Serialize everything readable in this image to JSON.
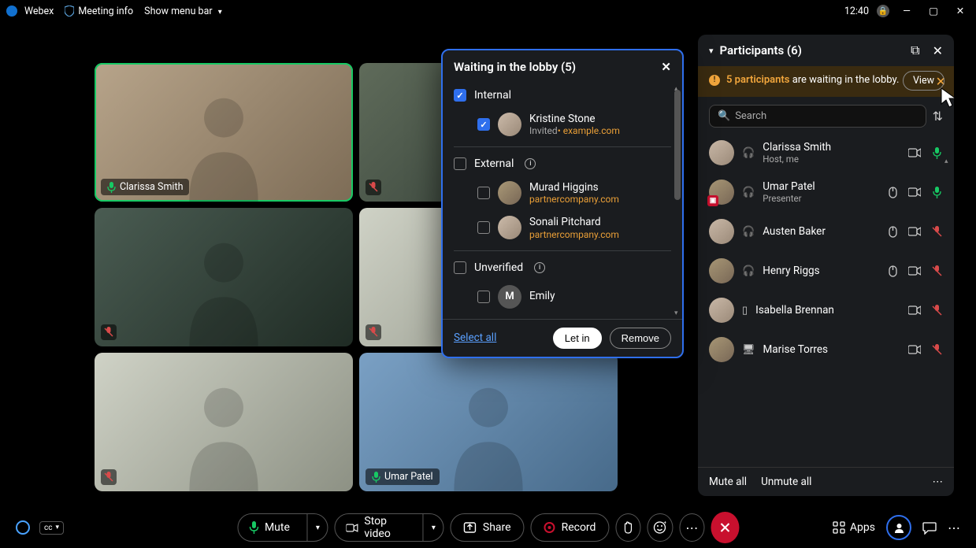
{
  "titlebar": {
    "app": "Webex",
    "meeting_info": "Meeting info",
    "show_menu": "Show menu bar",
    "time": "12:40"
  },
  "tiles": {
    "clarissa": "Clarissa Smith",
    "umar": "Umar Patel"
  },
  "lobby": {
    "title": "Waiting in the lobby (5)",
    "internal_label": "Internal",
    "external_label": "External",
    "unverified_label": "Unverified",
    "kristine_name": "Kristine Stone",
    "kristine_invited": "Invited",
    "kristine_domain": "example.com",
    "murad_name": "Murad Higgins",
    "murad_domain": "partnercompany.com",
    "sonali_name": "Sonali Pitchard",
    "sonali_domain": "partnercompany.com",
    "emily_initial": "M",
    "emily_name": "Emily",
    "select_all": "Select all",
    "let_in": "Let in",
    "remove": "Remove"
  },
  "panel": {
    "title": "Participants (6)",
    "notice_bold": "5 participants",
    "notice_rest": " are waiting in the lobby.",
    "view": "View",
    "search_placeholder": "Search",
    "p1_name": "Clarissa Smith",
    "p1_role": "Host, me",
    "p2_name": "Umar Patel",
    "p2_role": "Presenter",
    "p3_name": "Austen Baker",
    "p4_name": "Henry Riggs",
    "p5_name": "Isabella Brennan",
    "p6_name": "Marise Torres",
    "mute_all": "Mute all",
    "unmute_all": "Unmute all"
  },
  "bottom": {
    "mute": "Mute",
    "stop_video": "Stop video",
    "share": "Share",
    "record": "Record",
    "apps": "Apps"
  }
}
